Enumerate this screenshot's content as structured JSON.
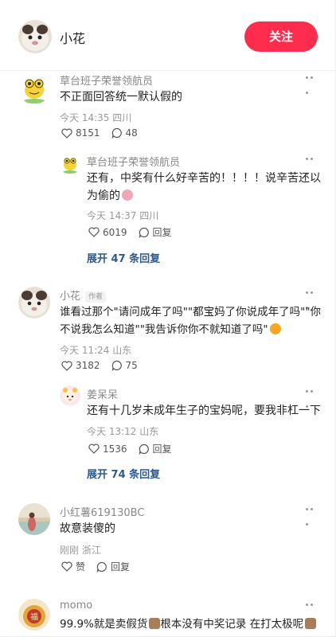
{
  "header": {
    "name": "小花",
    "follow_label": "关注"
  },
  "comments": [
    {
      "author": "草台班子荣誉领航员",
      "text": "不正面回答统一默认假的",
      "date": "今天 14:35",
      "location": "四川",
      "likes": "8151",
      "replies": "48",
      "reply": {
        "author": "草台班子荣誉领航员",
        "text_line1": "还有，中奖有什么好辛苦的！！！！说辛苦还以",
        "text_line2": "为偷的",
        "date": "今天 14:37",
        "location": "四川",
        "likes": "6019",
        "reply_label": "回复"
      },
      "expand_label": "展开 47 条回复"
    },
    {
      "author": "小花",
      "author_tag": "作者",
      "text_line1": "谁看过那个\"请问成年了吗\"\"都宝妈了你说成年了吗\"\"你",
      "text_line2": "不说我怎么知道\"\"我告诉你你不就知道了吗\"",
      "date": "今天 11:24",
      "location": "山东",
      "likes": "3182",
      "replies": "75",
      "reply": {
        "author": "姜呆呆",
        "text": "还有十几岁未成年生子的宝妈呢，要我非杠一下",
        "date": "今天 13:12",
        "location": "山东",
        "likes": "1536",
        "reply_label": "回复"
      },
      "expand_label": "展开 74 条回复"
    },
    {
      "author": "小红薯619130BC",
      "text": "故意装傻的",
      "date": "刚刚",
      "location": "浙江",
      "like_label": "赞",
      "reply_label": "回复"
    },
    {
      "author": "momo",
      "text": "99.9%就是卖假货",
      "text_mid": "根本没有中奖记录 在打太极呢"
    }
  ]
}
